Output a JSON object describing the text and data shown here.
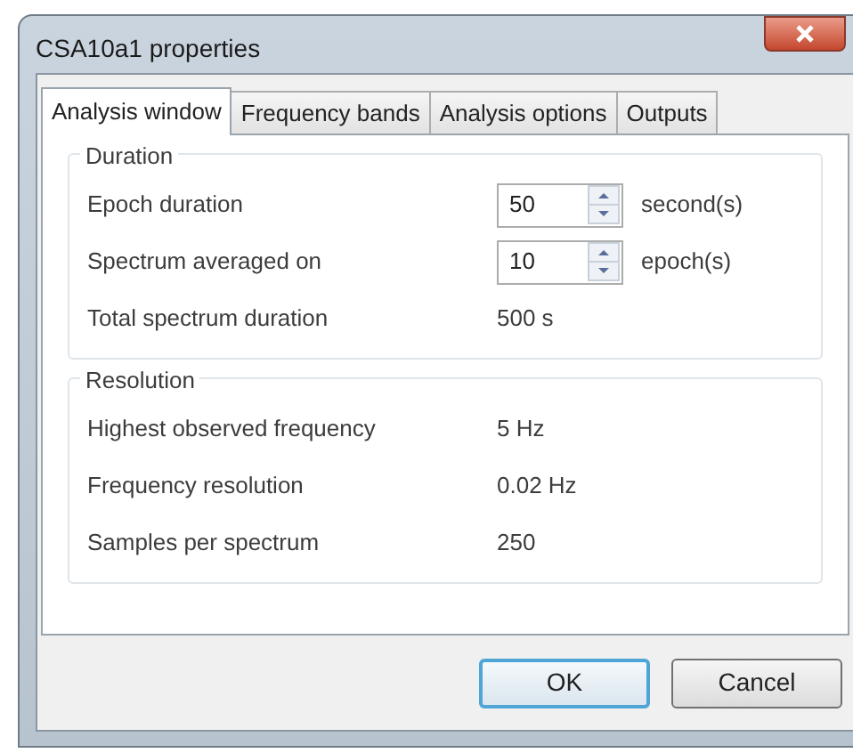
{
  "window": {
    "title": "CSA10a1 properties"
  },
  "tabs": [
    {
      "label": "Analysis window",
      "selected": true
    },
    {
      "label": "Frequency bands",
      "selected": false
    },
    {
      "label": "Analysis options",
      "selected": false
    },
    {
      "label": "Outputs",
      "selected": false
    }
  ],
  "groups": [
    {
      "title": "Duration",
      "rows": [
        {
          "kind": "spin",
          "label": "Epoch duration",
          "value": "50",
          "unit": "second(s)"
        },
        {
          "kind": "spin",
          "label": "Spectrum averaged on",
          "value": "10",
          "unit": "epoch(s)"
        },
        {
          "kind": "value",
          "label": "Total spectrum duration",
          "value": "500 s"
        }
      ]
    },
    {
      "title": "Resolution",
      "rows": [
        {
          "kind": "value",
          "label": "Highest observed frequency",
          "value": "5 Hz"
        },
        {
          "kind": "value",
          "label": "Frequency resolution",
          "value": "0.02 Hz"
        },
        {
          "kind": "value",
          "label": "Samples per spectrum",
          "value": "250"
        }
      ]
    }
  ],
  "buttons": [
    {
      "label": "OK",
      "default": true
    },
    {
      "label": "Cancel",
      "default": false
    }
  ]
}
